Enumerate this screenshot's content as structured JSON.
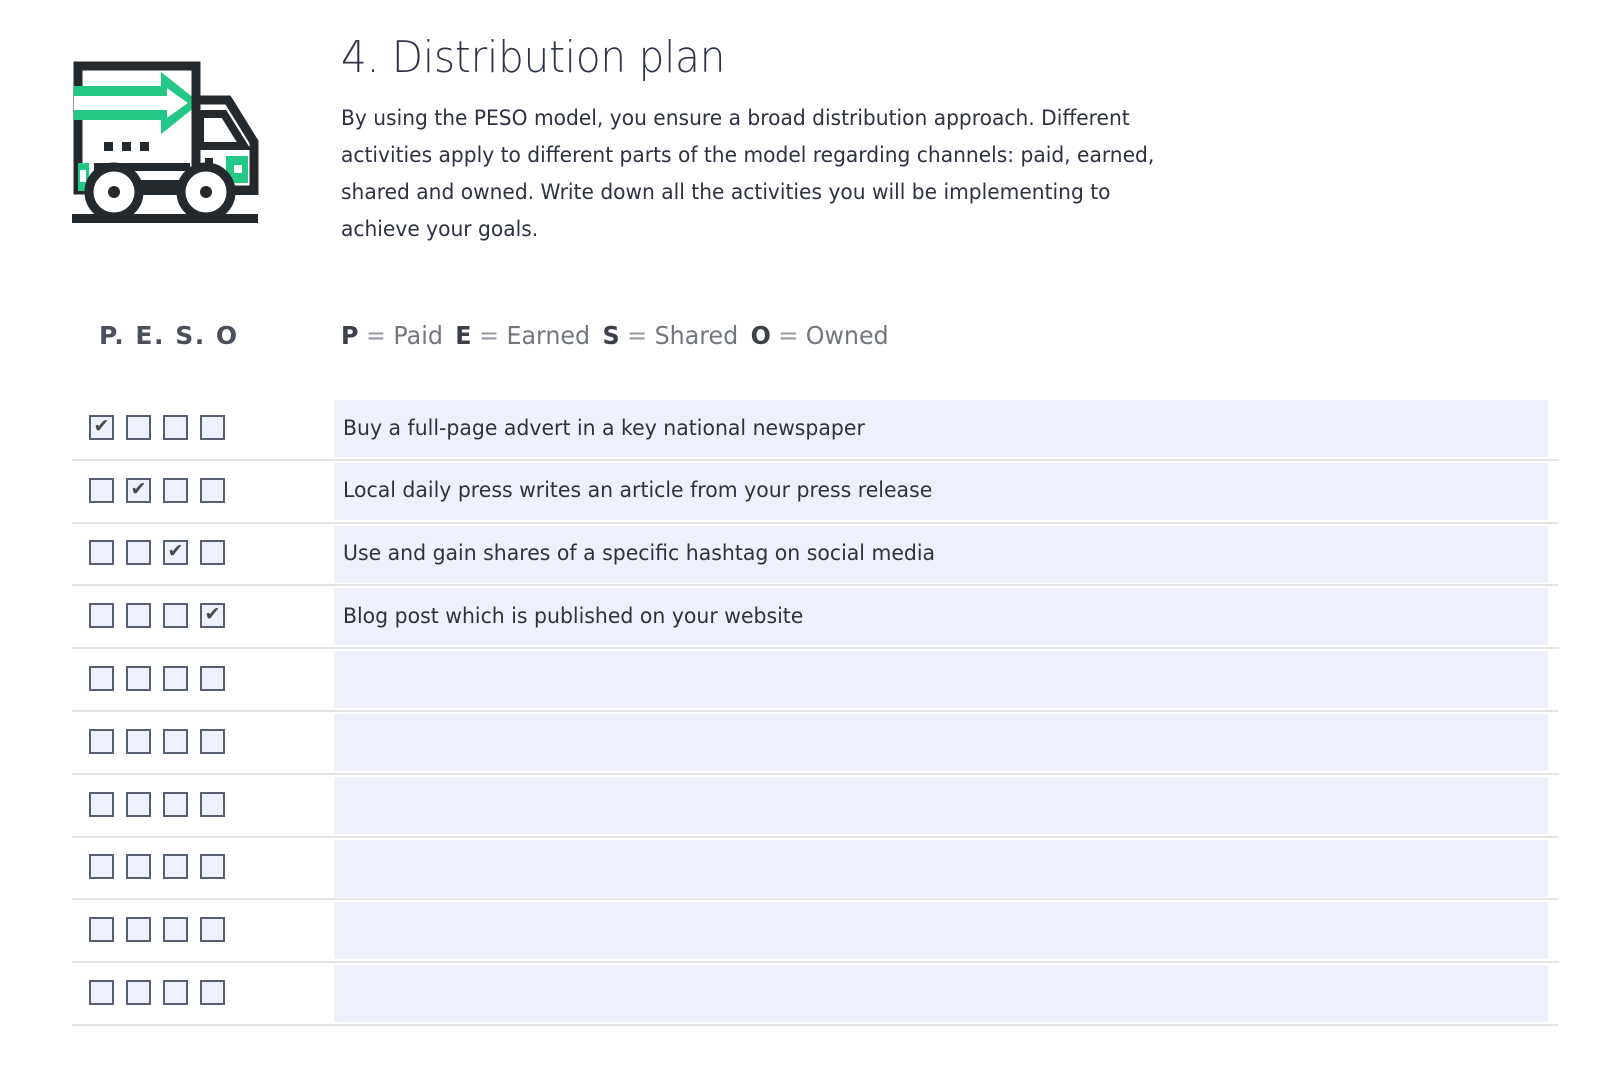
{
  "header": {
    "icon_name": "delivery-truck-icon",
    "title": "4. Distribution plan",
    "description": "By using the PESO model, you ensure a broad distribution approach. Different activities apply to different parts of the model regarding channels:  paid, earned, shared and owned. Write down all the activities you will be implementing to achieve your goals."
  },
  "legend": {
    "peso_label": "P. E. S. O",
    "items": [
      {
        "letter": "P",
        "equals": "=",
        "meaning": "Paid"
      },
      {
        "letter": "E",
        "equals": "=",
        "meaning": "Earned"
      },
      {
        "letter": "S",
        "equals": "=",
        "meaning": "Shared"
      },
      {
        "letter": "O",
        "equals": "=",
        "meaning": "Owned"
      }
    ]
  },
  "table": {
    "checkbox_columns": [
      "P",
      "E",
      "S",
      "O"
    ],
    "check_glyph": "✔",
    "rows": [
      {
        "checks": [
          true,
          false,
          false,
          false
        ],
        "text": "Buy a full-page advert in a key national newspaper"
      },
      {
        "checks": [
          false,
          true,
          false,
          false
        ],
        "text": "Local daily press writes an article from your press release"
      },
      {
        "checks": [
          false,
          false,
          true,
          false
        ],
        "text": "Use and gain shares of a specific hashtag on social media"
      },
      {
        "checks": [
          false,
          false,
          false,
          true
        ],
        "text": "Blog post which is published on your website"
      },
      {
        "checks": [
          false,
          false,
          false,
          false
        ],
        "text": ""
      },
      {
        "checks": [
          false,
          false,
          false,
          false
        ],
        "text": ""
      },
      {
        "checks": [
          false,
          false,
          false,
          false
        ],
        "text": ""
      },
      {
        "checks": [
          false,
          false,
          false,
          false
        ],
        "text": ""
      },
      {
        "checks": [
          false,
          false,
          false,
          false
        ],
        "text": ""
      },
      {
        "checks": [
          false,
          false,
          false,
          false
        ],
        "text": ""
      }
    ]
  },
  "colors": {
    "accent_green": "#23c884",
    "icon_dark": "#24292e",
    "text_dark": "#2d3142",
    "field_bg": "#eef0fb",
    "separator": "#e4e4e6",
    "checkbox_border": "#595f73"
  }
}
